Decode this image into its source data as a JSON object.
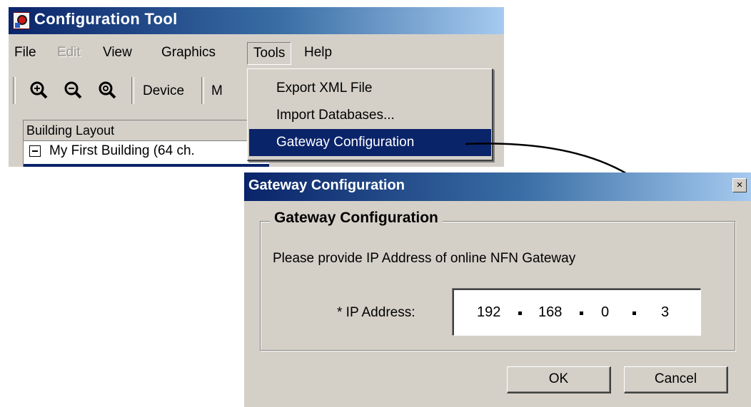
{
  "app": {
    "title": "Configuration Tool",
    "menus": [
      "File",
      "Edit",
      "View",
      "Graphics",
      "Tools",
      "Help"
    ],
    "disabled_menu": "Edit",
    "open_menu": "Tools",
    "toolbar": {
      "icons": [
        "zoom-in-icon",
        "zoom-out-icon",
        "zoom-fit-icon"
      ],
      "device_button_label": "Device",
      "next_button_partial_label": "M"
    },
    "layout_panel": {
      "header": "Building Layout",
      "tree_root": "My First Building (64 ch."
    }
  },
  "tools_menu": {
    "items": [
      "Export XML File",
      "Import Databases...",
      "Gateway Configuration"
    ],
    "highlighted_index": 2
  },
  "dialog": {
    "title": "Gateway Configuration",
    "close_glyph": "×",
    "group_title": "Gateway Configuration",
    "prompt": "Please provide IP Address of online NFN Gateway",
    "ip_label": "* IP Address:",
    "ip_octets": [
      "192",
      "168",
      "0",
      "3"
    ],
    "ok_label": "OK",
    "cancel_label": "Cancel"
  },
  "colors": {
    "titlebar_start": "#0a246a",
    "titlebar_end": "#a6caf0",
    "window_face": "#d4d0c8",
    "highlight": "#0a246a"
  }
}
